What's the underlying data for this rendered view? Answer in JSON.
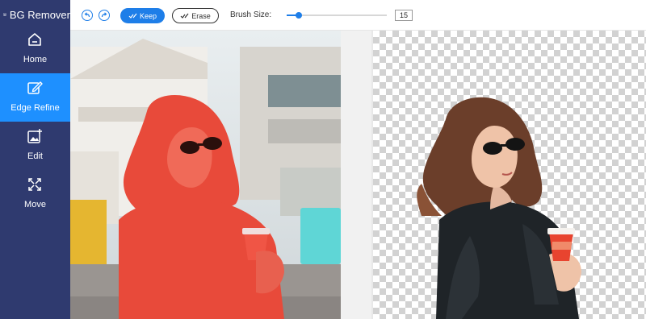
{
  "app": {
    "title": "BG Remover"
  },
  "sidebar": {
    "items": [
      {
        "label": "Home",
        "icon": "home-icon"
      },
      {
        "label": "Edge Refine",
        "icon": "edge-refine-icon",
        "active": true
      },
      {
        "label": "Edit",
        "icon": "edit-image-icon"
      },
      {
        "label": "Move",
        "icon": "move-icon"
      }
    ]
  },
  "toolbar": {
    "undo_icon": "undo-icon",
    "redo_icon": "redo-icon",
    "keep_label": "Keep",
    "erase_label": "Erase",
    "brush_size_label": "Brush Size:",
    "brush_size_value": "15",
    "brush_size_fraction": 0.12
  },
  "colors": {
    "sidebar_bg": "#2f3a6f",
    "active_nav": "#1e90ff",
    "accent": "#1e7ee8",
    "keep_overlay": "#e84a3a"
  }
}
